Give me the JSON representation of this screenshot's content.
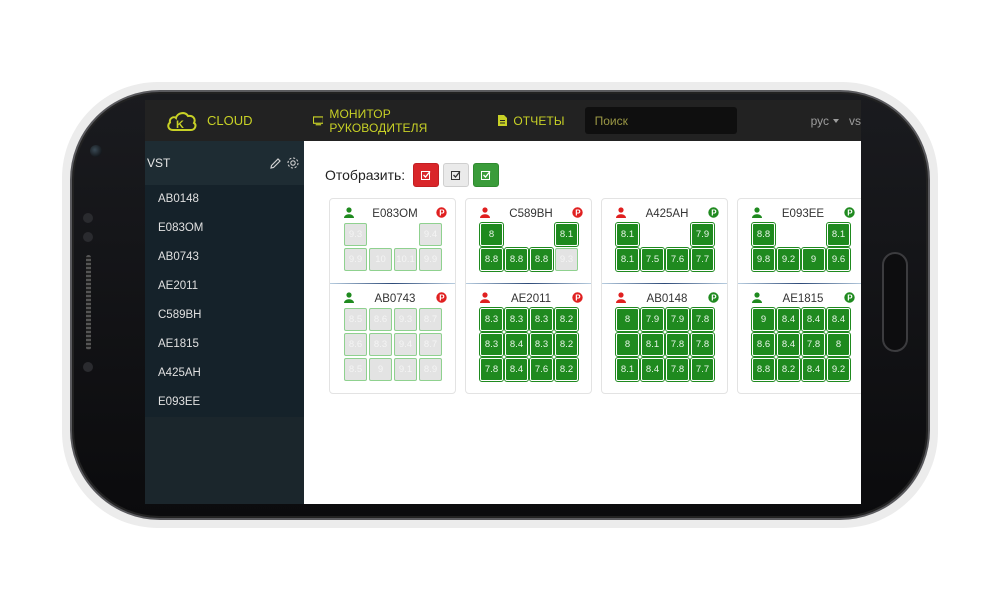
{
  "navbar": {
    "brand": "CLOUD",
    "brand_logo_letter": "K",
    "links": [
      {
        "label": "МОНИТОР РУКОВОДИТЕЛЯ",
        "icon": "monitor-icon"
      },
      {
        "label": "ОТЧЕТЫ",
        "icon": "document-icon"
      }
    ],
    "search_placeholder": "Поиск",
    "language": "рус",
    "user": "vs"
  },
  "sidebar": {
    "group": "VST",
    "items": [
      "AB0148",
      "E083OM",
      "AB0743",
      "AE2011",
      "C589BH",
      "AE1815",
      "A425AH",
      "E093EE"
    ]
  },
  "main": {
    "display_label": "Отобразить:",
    "filters": [
      {
        "name": "red",
        "color": "#d9262a"
      },
      {
        "name": "gray",
        "color": "#eaeaea"
      },
      {
        "name": "green",
        "color": "#3a9c3a"
      }
    ],
    "colors": {
      "ok": "#1f8a1f",
      "off": "#e3e3e3",
      "driver_green": "#1f8a1f",
      "driver_red": "#e02020"
    },
    "columns": [
      {
        "top": {
          "plate": "E083OM",
          "driver": "green",
          "parking": "red",
          "layout": "4",
          "values": [
            "9.3",
            "",
            "",
            "9.4",
            "9.9",
            "10",
            "10.1",
            "9.9"
          ],
          "status": [
            "off",
            "empty",
            "empty",
            "off",
            "off",
            "off",
            "off",
            "off"
          ]
        },
        "bottom": {
          "plate": "AB0743",
          "driver": "green",
          "parking": "red",
          "layout": "12",
          "values": [
            "8.5",
            "8.6",
            "9.3",
            "8.7",
            "8.6",
            "8.3",
            "9.4",
            "8.7",
            "8.5",
            "9",
            "9.1",
            "8.9"
          ],
          "status": [
            "off",
            "off",
            "off",
            "off",
            "off",
            "off",
            "off",
            "off",
            "off",
            "off",
            "off",
            "off"
          ]
        }
      },
      {
        "top": {
          "plate": "C589BH",
          "driver": "red",
          "parking": "red",
          "layout": "4",
          "values": [
            "8",
            "",
            "",
            "8.1",
            "8.8",
            "8.8",
            "8.8",
            "9.3"
          ],
          "status": [
            "ok",
            "empty",
            "empty",
            "ok",
            "ok",
            "ok",
            "ok",
            "off"
          ]
        },
        "bottom": {
          "plate": "AE2011",
          "driver": "red",
          "parking": "red",
          "layout": "12",
          "values": [
            "8.3",
            "8.3",
            "8.3",
            "8.2",
            "8.3",
            "8.4",
            "8.3",
            "8.2",
            "7.8",
            "8.4",
            "7.6",
            "8.2"
          ],
          "status": [
            "ok",
            "ok",
            "ok",
            "ok",
            "ok",
            "ok",
            "ok",
            "ok",
            "ok",
            "ok",
            "ok",
            "ok"
          ]
        }
      },
      {
        "top": {
          "plate": "A425AH",
          "driver": "red",
          "parking": "green",
          "layout": "4",
          "values": [
            "8.1",
            "",
            "",
            "7.9",
            "8.1",
            "7.5",
            "7.6",
            "7.7"
          ],
          "status": [
            "ok",
            "empty",
            "empty",
            "ok",
            "ok",
            "ok",
            "ok",
            "ok"
          ]
        },
        "bottom": {
          "plate": "AB0148",
          "driver": "red",
          "parking": "green",
          "layout": "12",
          "values": [
            "8",
            "7.9",
            "7.9",
            "7.8",
            "8",
            "8.1",
            "7.8",
            "7.8",
            "8.1",
            "8.4",
            "7.8",
            "7.7"
          ],
          "status": [
            "ok",
            "ok",
            "ok",
            "ok",
            "ok",
            "ok",
            "ok",
            "ok",
            "ok",
            "ok",
            "ok",
            "ok"
          ]
        }
      },
      {
        "top": {
          "plate": "E093EE",
          "driver": "green",
          "parking": "green",
          "layout": "4",
          "values": [
            "8.8",
            "",
            "",
            "8.1",
            "9.8",
            "9.2",
            "9",
            "9.6"
          ],
          "status": [
            "ok",
            "empty",
            "empty",
            "ok",
            "ok",
            "ok",
            "ok",
            "ok"
          ]
        },
        "bottom": {
          "plate": "AE1815",
          "driver": "green",
          "parking": "green",
          "layout": "12",
          "values": [
            "9",
            "8.4",
            "8.4",
            "8.4",
            "8.6",
            "8.4",
            "7.8",
            "8",
            "8.8",
            "8.2",
            "8.4",
            "9.2"
          ],
          "status": [
            "ok",
            "ok",
            "ok",
            "ok",
            "ok",
            "ok",
            "ok",
            "ok",
            "ok",
            "ok",
            "ok",
            "ok"
          ]
        }
      }
    ]
  }
}
